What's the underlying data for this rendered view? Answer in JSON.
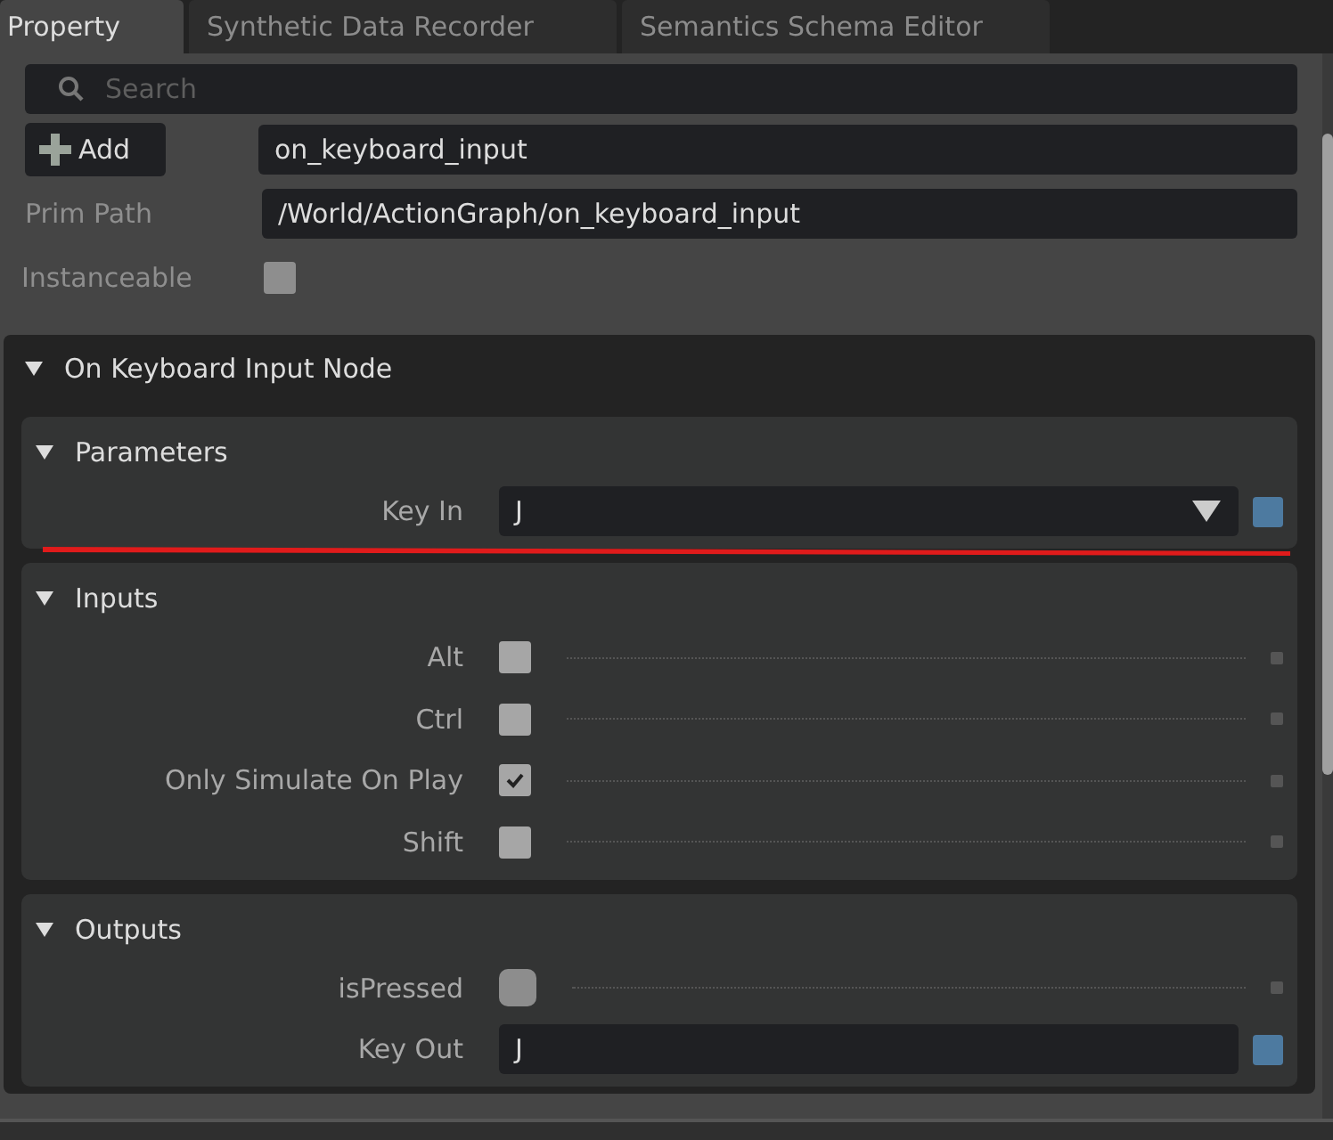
{
  "tabs": [
    {
      "label": "Property",
      "selected": true
    },
    {
      "label": "Synthetic Data Recorder",
      "selected": false
    },
    {
      "label": "Semantics Schema Editor",
      "selected": false
    }
  ],
  "search": {
    "placeholder": "Search"
  },
  "add_button": {
    "label": "Add"
  },
  "name_field": {
    "value": "on_keyboard_input"
  },
  "prim_path": {
    "label": "Prim Path",
    "value": "/World/ActionGraph/on_keyboard_input"
  },
  "instanceable": {
    "label": "Instanceable",
    "checked": false
  },
  "node": {
    "title": "On Keyboard Input Node",
    "expanded": true,
    "sections": [
      {
        "title": "Parameters",
        "expanded": true,
        "highlighted": true,
        "rows": [
          {
            "kind": "dropdown",
            "label": "Key In",
            "value": "J",
            "modified": true
          }
        ]
      },
      {
        "title": "Inputs",
        "expanded": true,
        "highlighted": false,
        "rows": [
          {
            "kind": "checkbox",
            "label": "Alt",
            "checked": false,
            "modified": false
          },
          {
            "kind": "checkbox",
            "label": "Ctrl",
            "checked": false,
            "modified": false
          },
          {
            "kind": "checkbox",
            "label": "Only Simulate On Play",
            "checked": true,
            "modified": false
          },
          {
            "kind": "checkbox",
            "label": "Shift",
            "checked": false,
            "modified": false
          }
        ]
      },
      {
        "title": "Outputs",
        "expanded": true,
        "highlighted": false,
        "rows": [
          {
            "kind": "readonly",
            "label": "isPressed",
            "checked": false,
            "modified": false
          },
          {
            "kind": "text",
            "label": "Key Out",
            "value": "J",
            "modified": true
          }
        ]
      }
    ]
  }
}
